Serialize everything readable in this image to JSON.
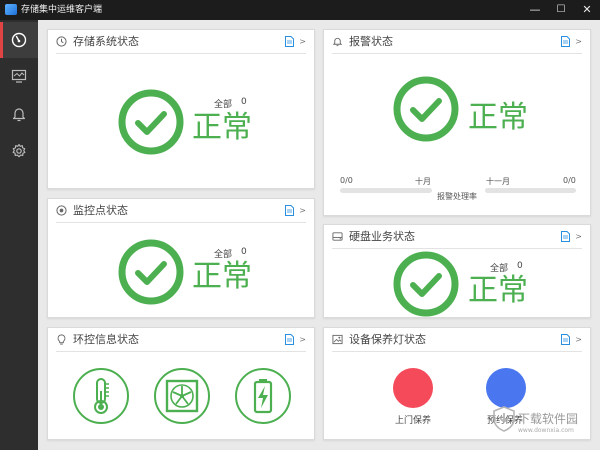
{
  "window": {
    "title": "存储集中运维客户端",
    "minimize": "—",
    "maximize": "☐",
    "close": "✕"
  },
  "sidebar": {
    "items": [
      {
        "icon": "gauge-icon",
        "active": true
      },
      {
        "icon": "monitor-icon",
        "active": false
      },
      {
        "icon": "bell-icon",
        "active": false
      },
      {
        "icon": "gear-icon",
        "active": false
      }
    ]
  },
  "panels": {
    "storage": {
      "title": "存储系统状态",
      "total_label": "全部",
      "total_value": "0",
      "status": "正常",
      "more": ">"
    },
    "monitor": {
      "title": "监控点状态",
      "total_label": "全部",
      "total_value": "0",
      "status": "正常",
      "more": ">"
    },
    "env": {
      "title": "环控信息状态",
      "more": ">",
      "icons": [
        "thermometer-icon",
        "fan-icon",
        "battery-icon"
      ]
    },
    "alarm": {
      "title": "报警状态",
      "status": "正常",
      "more": ">",
      "left_count": "0/0",
      "left_month": "十月",
      "right_month": "十一月",
      "right_count": "0/0",
      "rate_label": "报警处理率",
      "left_progress": 0,
      "right_progress": 0
    },
    "disk": {
      "title": "硬盘业务状态",
      "total_label": "全部",
      "total_value": "0",
      "status": "正常",
      "more": ">"
    },
    "maintenance": {
      "title": "设备保养灯状态",
      "more": ">",
      "onsite_label": "上门保养",
      "booked_label": "预约保养",
      "onsite_color": "#f44a5a",
      "booked_color": "#4a76ef"
    }
  },
  "colors": {
    "ok_green": "#4caf50",
    "alert_red": "#e04444"
  },
  "watermark": {
    "name": "下载软件园",
    "url": "www.downxia.com"
  }
}
